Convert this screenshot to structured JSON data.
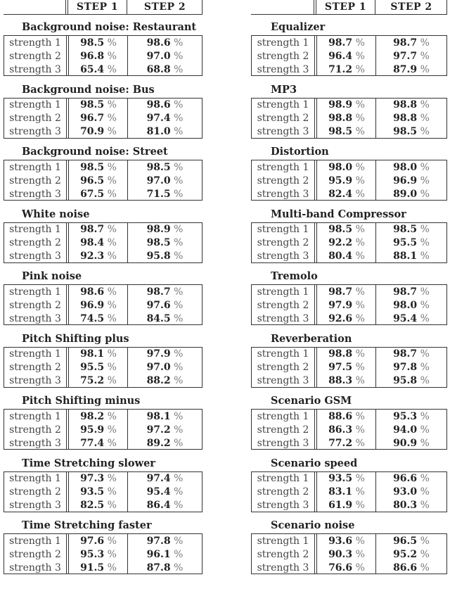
{
  "columns": {
    "step1": "STEP 1",
    "step2": "STEP 2"
  },
  "percent_sign": "%",
  "left": [
    {
      "title": "Background noise: Restaurant",
      "rows": [
        {
          "label": "strength 1",
          "step1": "98.5",
          "step2": "98.6"
        },
        {
          "label": "strength 2",
          "step1": "96.8",
          "step2": "97.0"
        },
        {
          "label": "strength 3",
          "step1": "65.4",
          "step2": "68.8"
        }
      ]
    },
    {
      "title": "Background noise: Bus",
      "rows": [
        {
          "label": "strength 1",
          "step1": "98.5",
          "step2": "98.6"
        },
        {
          "label": "strength 2",
          "step1": "96.7",
          "step2": "97.4"
        },
        {
          "label": "strength 3",
          "step1": "70.9",
          "step2": "81.0"
        }
      ]
    },
    {
      "title": "Background noise: Street",
      "rows": [
        {
          "label": "strength 1",
          "step1": "98.5",
          "step2": "98.5"
        },
        {
          "label": "strength 2",
          "step1": "96.5",
          "step2": "97.0"
        },
        {
          "label": "strength 3",
          "step1": "67.5",
          "step2": "71.5"
        }
      ]
    },
    {
      "title": "White noise",
      "rows": [
        {
          "label": "strength 1",
          "step1": "98.7",
          "step2": "98.9"
        },
        {
          "label": "strength 2",
          "step1": "98.4",
          "step2": "98.5"
        },
        {
          "label": "strength 3",
          "step1": "92.3",
          "step2": "95.8"
        }
      ]
    },
    {
      "title": "Pink noise",
      "rows": [
        {
          "label": "strength 1",
          "step1": "98.6",
          "step2": "98.7"
        },
        {
          "label": "strength 2",
          "step1": "96.9",
          "step2": "97.6"
        },
        {
          "label": "strength 3",
          "step1": "74.5",
          "step2": "84.5"
        }
      ]
    },
    {
      "title": "Pitch Shifting plus",
      "rows": [
        {
          "label": "strength 1",
          "step1": "98.1",
          "step2": "97.9"
        },
        {
          "label": "strength 2",
          "step1": "95.5",
          "step2": "97.0"
        },
        {
          "label": "strength 3",
          "step1": "75.2",
          "step2": "88.2"
        }
      ]
    },
    {
      "title": "Pitch Shifting minus",
      "rows": [
        {
          "label": "strength 1",
          "step1": "98.2",
          "step2": "98.1"
        },
        {
          "label": "strength 2",
          "step1": "95.9",
          "step2": "97.2"
        },
        {
          "label": "strength 3",
          "step1": "77.4",
          "step2": "89.2"
        }
      ]
    },
    {
      "title": "Time Stretching slower",
      "rows": [
        {
          "label": "strength 1",
          "step1": "97.3",
          "step2": "97.4"
        },
        {
          "label": "strength 2",
          "step1": "93.5",
          "step2": "95.4"
        },
        {
          "label": "strength 3",
          "step1": "82.5",
          "step2": "86.4"
        }
      ]
    },
    {
      "title": "Time Stretching faster",
      "rows": [
        {
          "label": "strength 1",
          "step1": "97.6",
          "step2": "97.8"
        },
        {
          "label": "strength 2",
          "step1": "95.3",
          "step2": "96.1"
        },
        {
          "label": "strength 3",
          "step1": "91.5",
          "step2": "87.8"
        }
      ]
    }
  ],
  "right": [
    {
      "title": "Equalizer",
      "rows": [
        {
          "label": "strength 1",
          "step1": "98.7",
          "step2": "98.7"
        },
        {
          "label": "strength 2",
          "step1": "96.4",
          "step2": "97.7"
        },
        {
          "label": "strength 3",
          "step1": "71.2",
          "step2": "87.9"
        }
      ]
    },
    {
      "title": "MP3",
      "rows": [
        {
          "label": "strength 1",
          "step1": "98.9",
          "step2": "98.8"
        },
        {
          "label": "strength 2",
          "step1": "98.8",
          "step2": "98.8"
        },
        {
          "label": "strength 3",
          "step1": "98.5",
          "step2": "98.5"
        }
      ]
    },
    {
      "title": "Distortion",
      "rows": [
        {
          "label": "strength 1",
          "step1": "98.0",
          "step2": "98.0"
        },
        {
          "label": "strength 2",
          "step1": "95.9",
          "step2": "96.9"
        },
        {
          "label": "strength 3",
          "step1": "82.4",
          "step2": "89.0"
        }
      ]
    },
    {
      "title": "Multi-band Compressor",
      "rows": [
        {
          "label": "strength 1",
          "step1": "98.5",
          "step2": "98.5"
        },
        {
          "label": "strength 2",
          "step1": "92.2",
          "step2": "95.5"
        },
        {
          "label": "strength 3",
          "step1": "80.4",
          "step2": "88.1"
        }
      ]
    },
    {
      "title": "Tremolo",
      "rows": [
        {
          "label": "strength 1",
          "step1": "98.7",
          "step2": "98.7"
        },
        {
          "label": "strength 2",
          "step1": "97.9",
          "step2": "98.0"
        },
        {
          "label": "strength 3",
          "step1": "92.6",
          "step2": "95.4"
        }
      ]
    },
    {
      "title": "Reverberation",
      "rows": [
        {
          "label": "strength 1",
          "step1": "98.8",
          "step2": "98.7"
        },
        {
          "label": "strength 2",
          "step1": "97.5",
          "step2": "97.8"
        },
        {
          "label": "strength 3",
          "step1": "88.3",
          "step2": "95.8"
        }
      ]
    },
    {
      "title": "Scenario GSM",
      "rows": [
        {
          "label": "strength 1",
          "step1": "88.6",
          "step2": "95.3"
        },
        {
          "label": "strength 2",
          "step1": "86.3",
          "step2": "94.0"
        },
        {
          "label": "strength 3",
          "step1": "77.2",
          "step2": "90.9"
        }
      ]
    },
    {
      "title": "Scenario speed",
      "rows": [
        {
          "label": "strength 1",
          "step1": "93.5",
          "step2": "96.6"
        },
        {
          "label": "strength 2",
          "step1": "83.1",
          "step2": "93.0"
        },
        {
          "label": "strength 3",
          "step1": "61.9",
          "step2": "80.3"
        }
      ]
    },
    {
      "title": "Scenario noise",
      "rows": [
        {
          "label": "strength 1",
          "step1": "93.6",
          "step2": "96.5"
        },
        {
          "label": "strength 2",
          "step1": "90.3",
          "step2": "95.2"
        },
        {
          "label": "strength 3",
          "step1": "76.6",
          "step2": "86.6"
        }
      ]
    }
  ]
}
